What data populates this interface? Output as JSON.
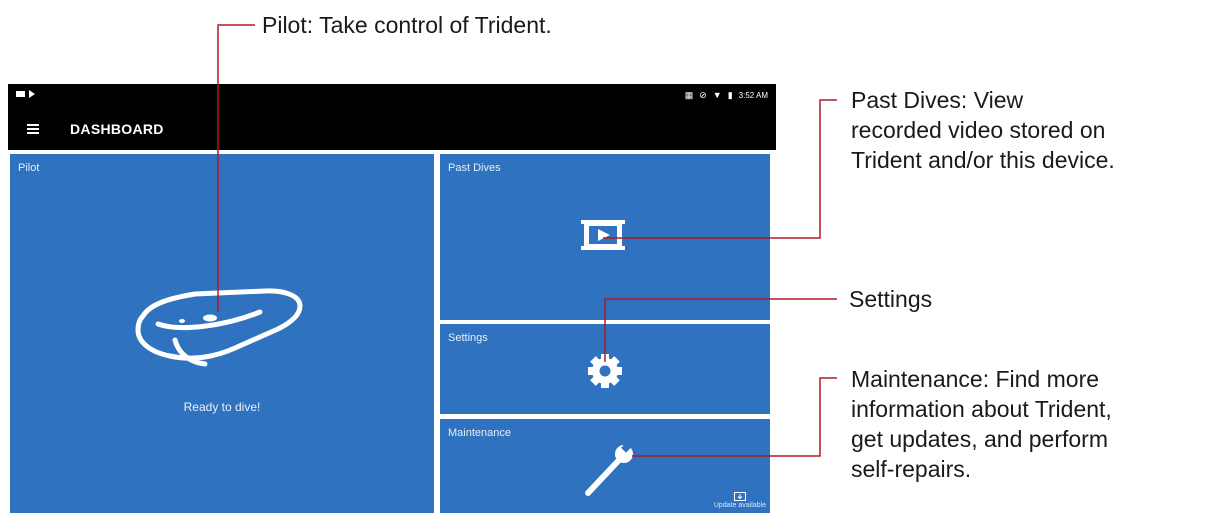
{
  "statusbar": {
    "time": "3:52 AM"
  },
  "appbar": {
    "title": "DASHBOARD"
  },
  "tiles": {
    "pilot": {
      "label": "Pilot",
      "status": "Ready to dive!"
    },
    "past_dives": {
      "label": "Past Dives"
    },
    "settings": {
      "label": "Settings"
    },
    "maintenance": {
      "label": "Maintenance",
      "update_text": "Update available"
    }
  },
  "annotations": {
    "pilot": "Pilot: Take control of Trident.",
    "past_dives": [
      "Past Dives: View",
      "recorded video stored on",
      "Trident and/or this device."
    ],
    "settings": "Settings",
    "maintenance": [
      "Maintenance: Find more",
      "information about Trident,",
      "get updates, and perform",
      "self-repairs."
    ]
  },
  "colors": {
    "tile": "#2e72c0",
    "leader": "#b0182a",
    "bar": "#000000"
  },
  "icons": [
    "drone-icon",
    "film-play-icon",
    "gear-icon",
    "wrench-icon",
    "update-icon",
    "menu-icon"
  ]
}
